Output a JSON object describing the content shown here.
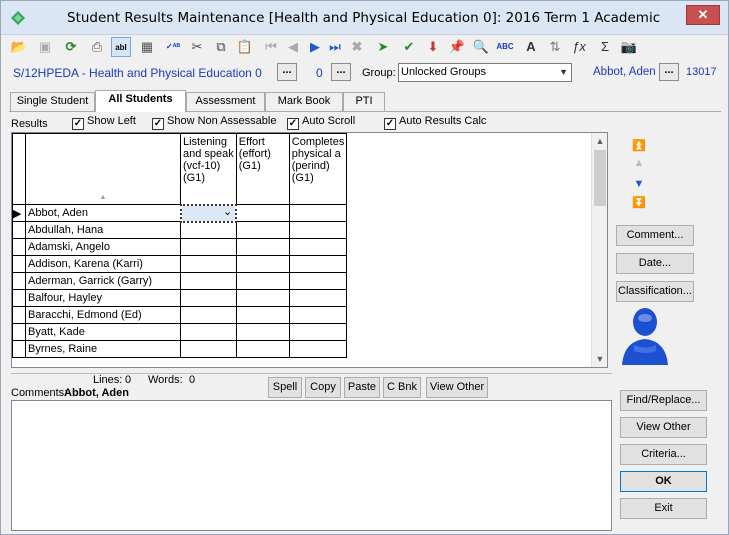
{
  "window": {
    "title": "Student Results Maintenance  [Health and Physical Education 0]:  2016 Term 1 Academic",
    "close_label": "✕"
  },
  "toolbar": {
    "icons": [
      "open-folder-icon",
      "save-icon",
      "refresh-icon",
      "print-icon",
      "text-field-icon",
      "calculator-icon",
      "spell-check-icon",
      "cut-icon",
      "copy-icon",
      "paste-icon",
      "first-record-icon",
      "previous-record-icon",
      "next-record-icon",
      "last-record-icon",
      "delete-icon",
      "import-icon",
      "approve-icon",
      "download-icon",
      "pin-icon",
      "preview-icon",
      "spell-abc-icon",
      "font-icon",
      "sort-icon",
      "function-icon",
      "sum-icon",
      "camera-icon"
    ]
  },
  "course": {
    "code_label": "S/12HPEDA - Health and Physical Education 0",
    "count": "0",
    "group_label": "Group:",
    "group_value": "Unlocked Groups",
    "student_name": "Abbot, Aden",
    "student_id": "13017",
    "dots": "..."
  },
  "tabs": [
    "Single Student",
    "All Students",
    "Assessment",
    "Mark Book",
    "PTI"
  ],
  "options": {
    "results_label": "Results",
    "show_left": "Show Left",
    "show_non_assessable": "Show Non Assessable",
    "auto_scroll": "Auto Scroll",
    "auto_results_calc": "Auto Results Calc"
  },
  "grid": {
    "sort_glyph": "▲",
    "columns": [
      {
        "line1": "Listening",
        "line2": "and speak",
        "line3": "(vcf-10)",
        "line4": "(G1)"
      },
      {
        "line1": "Effort",
        "line2": "(effort)",
        "line3": "(G1)",
        "line4": ""
      },
      {
        "line1": "Completes",
        "line2": "physical a",
        "line3": "(perind)",
        "line4": "(G1)"
      }
    ],
    "rows": [
      "Abbot, Aden",
      "Abdullah, Hana",
      "Adamski, Angelo",
      "Addison, Karena (Karri)",
      "Aderman, Garrick (Garry)",
      "Balfour, Hayley",
      "Baracchi, Edmond (Ed)",
      "Byatt, Kade",
      "Byrnes, Raine"
    ],
    "row_indicator": "▶",
    "dropdown_glyph": "⌄"
  },
  "side_buttons": {
    "comment": "Comment...",
    "date": "Date...",
    "classification": "Classification...",
    "find_replace": "Find/Replace...",
    "view_other": "View Other",
    "criteria": "Criteria...",
    "ok": "OK",
    "exit": "Exit"
  },
  "comments": {
    "lines_label": "Lines:",
    "lines_value": "0",
    "words_label": "Words:",
    "words_value": "0",
    "label": "Comments:",
    "student": "Abbot, Aden",
    "spell": "Spell",
    "copy": "Copy",
    "paste": "Paste",
    "cbnk": "C Bnk",
    "view_other": "View Other"
  }
}
